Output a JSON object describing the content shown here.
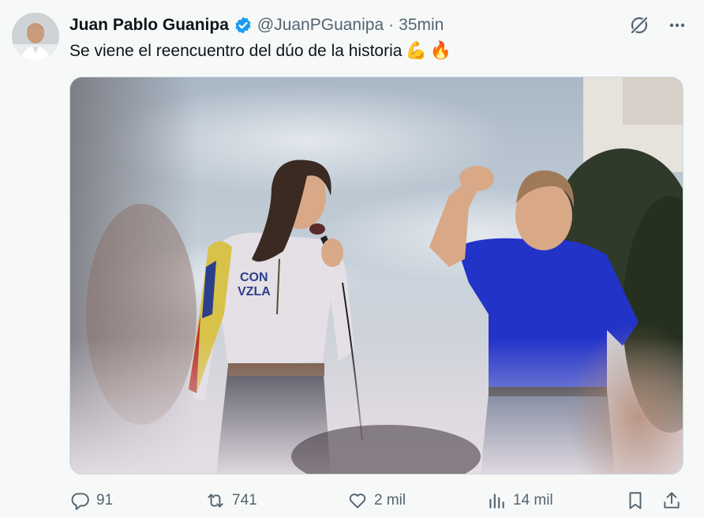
{
  "tweet": {
    "author_name": "Juan Pablo Guanipa",
    "handle": "@JuanPGuanipa",
    "separator": "·",
    "time": "35min",
    "text": "Se viene el reencuentro del dúo de la historia",
    "emojis": [
      "💪",
      "🔥"
    ],
    "verified_color": "#1d9bf0"
  },
  "media": {
    "shirt_text_line1": "CON",
    "shirt_text_line2": "VZLA"
  },
  "actions": {
    "replies": "91",
    "retweets": "741",
    "likes": "2 mil",
    "views": "14 mil"
  },
  "icons": {
    "reply": "reply-icon",
    "retweet": "retweet-icon",
    "like": "heart-icon",
    "views": "views-icon",
    "bookmark": "bookmark-icon",
    "share": "share-icon",
    "grok": "grok-icon",
    "more": "more-icon"
  }
}
